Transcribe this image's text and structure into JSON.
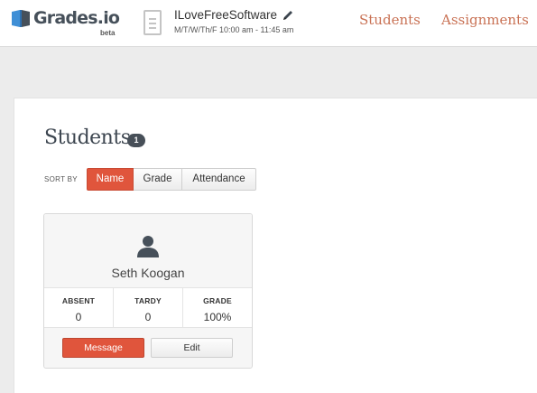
{
  "app": {
    "logo_text": "Grades.io",
    "logo_beta": "beta"
  },
  "class_info": {
    "name": "ILoveFreeSoftware",
    "schedule": "M/T/W/Th/F 10:00 am - 11:45 am"
  },
  "nav": {
    "students": "Students",
    "assignments": "Assignments"
  },
  "main": {
    "title": "Students",
    "count": "1",
    "sort_label": "SORT BY",
    "sort_options": [
      {
        "label": "Name",
        "active": true
      },
      {
        "label": "Grade",
        "active": false
      },
      {
        "label": "Attendance",
        "active": false
      }
    ]
  },
  "student": {
    "name": "Seth Koogan",
    "stats": [
      {
        "label": "ABSENT",
        "value": "0"
      },
      {
        "label": "TARDY",
        "value": "0"
      },
      {
        "label": "GRADE",
        "value": "100%"
      }
    ],
    "message_label": "Message",
    "edit_label": "Edit"
  },
  "colors": {
    "accent": "#e0553c",
    "nav_link": "#c97255",
    "title": "#3d4650"
  },
  "icons": [
    "book-logo-icon",
    "document-icon",
    "pencil-icon",
    "user-avatar-icon"
  ]
}
